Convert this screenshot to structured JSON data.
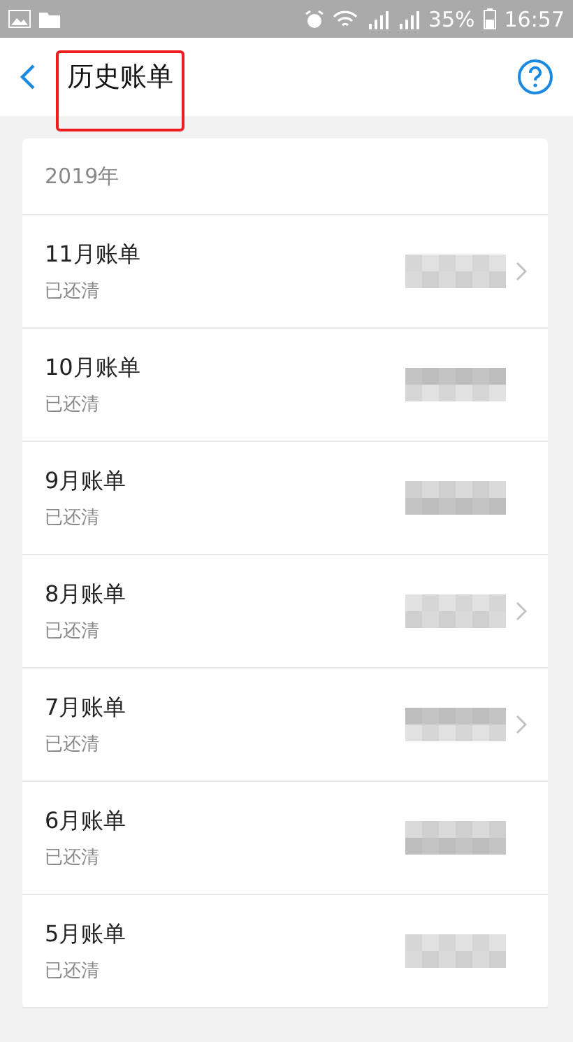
{
  "status_bar": {
    "battery": "35%",
    "time": "16:57"
  },
  "header": {
    "title": "历史账单",
    "title_marked": true
  },
  "year": "2019年",
  "bills": [
    {
      "title": "11月账单",
      "status": "已还清",
      "has_arrow": true
    },
    {
      "title": "10月账单",
      "status": "已还清",
      "has_arrow": false
    },
    {
      "title": "9月账单",
      "status": "已还清",
      "has_arrow": false
    },
    {
      "title": "8月账单",
      "status": "已还清",
      "has_arrow": true
    },
    {
      "title": "7月账单",
      "status": "已还清",
      "has_arrow": true
    },
    {
      "title": "6月账单",
      "status": "已还清",
      "has_arrow": false
    },
    {
      "title": "5月账单",
      "status": "已还清",
      "has_arrow": false
    }
  ]
}
